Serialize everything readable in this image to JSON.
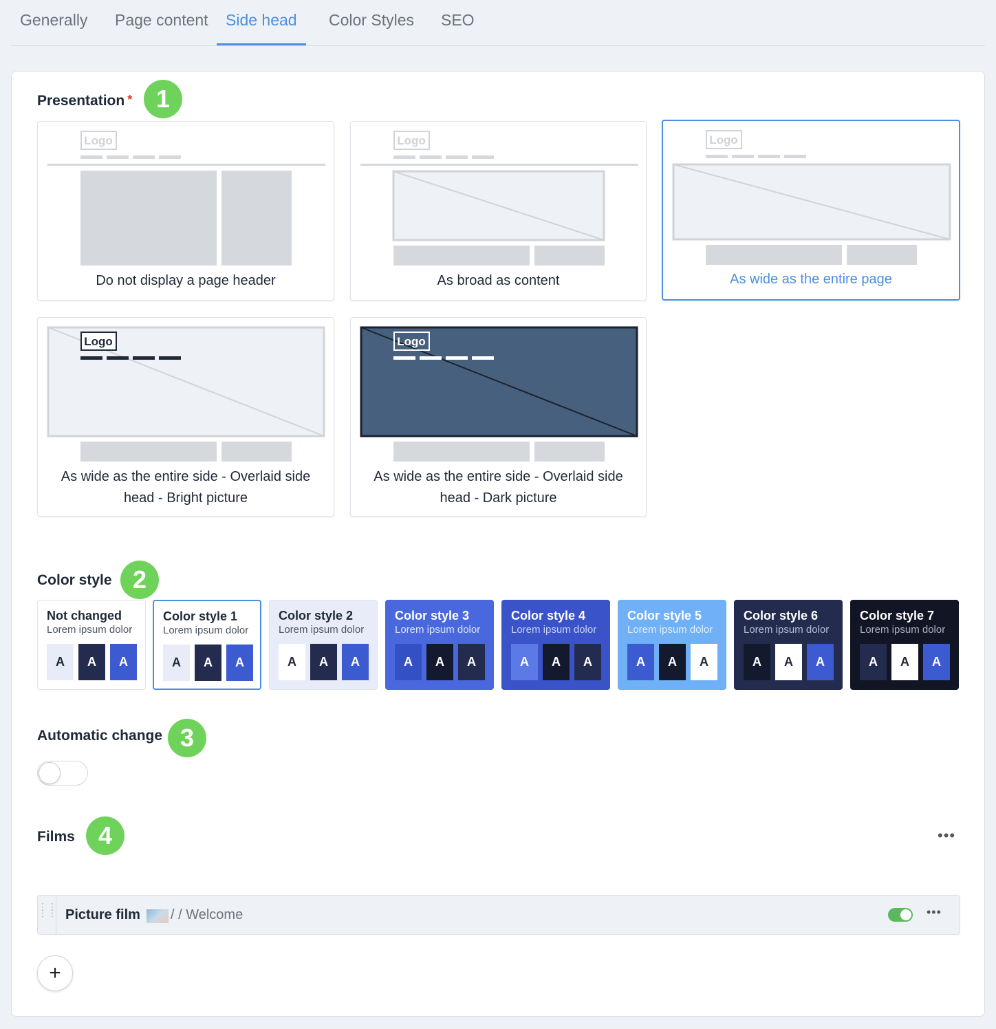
{
  "tabs": [
    "Generally",
    "Page content",
    "Side head",
    "Color Styles",
    "SEO"
  ],
  "active_tab": "Side head",
  "presentation": {
    "label": "Presentation",
    "required_mark": "*",
    "badge": "1",
    "logo_text": "Logo",
    "options": [
      "Do not display a page header",
      "As broad as content",
      "As wide as the entire page",
      "As wide as the entire side - Overlaid side head - Bright picture",
      "As wide as the entire side - Overlaid side head - Dark picture"
    ],
    "selected_index": 2
  },
  "color_style": {
    "label": "Color style",
    "badge": "2",
    "swatch_letter": "A",
    "options": [
      {
        "title": "Not changed",
        "subtitle": "Lorem ipsum dolor",
        "bg": "#ffffff",
        "fg": "#1f2937",
        "sub_color": "#4b5563",
        "swatches": [
          [
            "#e8ecf8",
            "#1f2937"
          ],
          [
            "#232c4f",
            "#ffffff"
          ],
          [
            "#3d5bd0",
            "#ffffff"
          ]
        ]
      },
      {
        "title": "Color style 1",
        "subtitle": "Lorem ipsum dolor",
        "bg": "#ffffff",
        "fg": "#1f2937",
        "sub_color": "#4b5563",
        "swatches": [
          [
            "#e8ecf8",
            "#1f2937"
          ],
          [
            "#232c4f",
            "#ffffff"
          ],
          [
            "#3d5bd0",
            "#ffffff"
          ]
        ]
      },
      {
        "title": "Color style 2",
        "subtitle": "Lorem ipsum dolor",
        "bg": "#e8ecf8",
        "fg": "#1f2937",
        "sub_color": "#4b5563",
        "swatches": [
          [
            "#ffffff",
            "#1f2937"
          ],
          [
            "#232c4f",
            "#ffffff"
          ],
          [
            "#3d5bd0",
            "#ffffff"
          ]
        ]
      },
      {
        "title": "Color style 3",
        "subtitle": "Lorem ipsum dolor",
        "bg": "#4a68de",
        "fg": "#ffffff",
        "sub_color": "#dbe3ff",
        "swatches": [
          [
            "#3550c4",
            "#ffffff"
          ],
          [
            "#141a2e",
            "#ffffff"
          ],
          [
            "#232c4f",
            "#ffffff"
          ]
        ]
      },
      {
        "title": "Color style 4",
        "subtitle": "Lorem ipsum dolor",
        "bg": "#3b53c9",
        "fg": "#ffffff",
        "sub_color": "#c8d2f7",
        "swatches": [
          [
            "#5b7ae6",
            "#ffffff"
          ],
          [
            "#141a2e",
            "#ffffff"
          ],
          [
            "#232c4f",
            "#ffffff"
          ]
        ]
      },
      {
        "title": "Color style 5",
        "subtitle": "Lorem ipsum dolor",
        "bg": "#6fb0f7",
        "fg": "#ffffff",
        "sub_color": "#e3f0ff",
        "swatches": [
          [
            "#3d5bd0",
            "#ffffff"
          ],
          [
            "#141a2e",
            "#ffffff"
          ],
          [
            "#ffffff",
            "#1f2937"
          ]
        ]
      },
      {
        "title": "Color style 6",
        "subtitle": "Lorem ipsum dolor",
        "bg": "#232c4f",
        "fg": "#ffffff",
        "sub_color": "#b7bfd6",
        "swatches": [
          [
            "#141a2e",
            "#ffffff"
          ],
          [
            "#ffffff",
            "#1f2937"
          ],
          [
            "#3d5bd0",
            "#ffffff"
          ]
        ]
      },
      {
        "title": "Color style 7",
        "subtitle": "Lorem ipsum dolor",
        "bg": "#111524",
        "fg": "#ffffff",
        "sub_color": "#aab2c8",
        "swatches": [
          [
            "#232c4f",
            "#ffffff"
          ],
          [
            "#ffffff",
            "#1f2937"
          ],
          [
            "#3d5bd0",
            "#ffffff"
          ]
        ]
      }
    ],
    "selected_index": 1
  },
  "automatic_change": {
    "label": "Automatic change",
    "badge": "3",
    "enabled": false
  },
  "films": {
    "label": "Films",
    "badge": "4",
    "menu_icon": "more-dots-icon",
    "items": [
      {
        "title": "Picture film",
        "path": "/ / Welcome",
        "enabled": true
      }
    ],
    "add_icon": "plus-icon"
  },
  "colors": {
    "accent": "#4a90e2",
    "badge": "#6fd35b",
    "toggle_on": "#5cb85c",
    "required": "#e53935"
  }
}
